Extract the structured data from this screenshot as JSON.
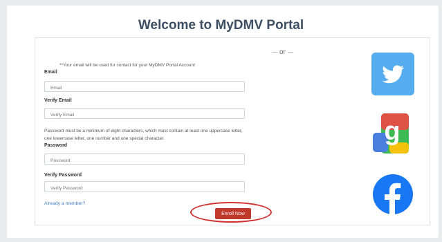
{
  "page": {
    "title": "Welcome to MyDMV Portal",
    "or_text": "or"
  },
  "form": {
    "email_note": "**Your email will be used for contact for your MyDMV Portal Account",
    "email_label": "Email",
    "email_placeholder": "Email",
    "verify_email_label": "Verify Email",
    "verify_email_placeholder": "Verify Email",
    "password_rules": "Password must be a minimum of eight characters, which must contain at least one uppercase letter, one lowercase letter, one number and one special character.",
    "password_label": "Password",
    "password_placeholder": "Password",
    "verify_password_label": "Verify Password",
    "verify_password_placeholder": "Verify Password",
    "already_member": "Already a member?",
    "enroll_button": "Enroll Now"
  },
  "social": {
    "twitter_icon": "twitter-icon",
    "google_icon": "google-icon",
    "facebook_icon": "facebook-icon"
  },
  "colors": {
    "title": "#3d4f63",
    "enroll_button": "#c0392b",
    "annotation_circle": "#d22f2f",
    "link": "#3b78c4",
    "twitter": "#55acee",
    "facebook": "#1877f2"
  }
}
